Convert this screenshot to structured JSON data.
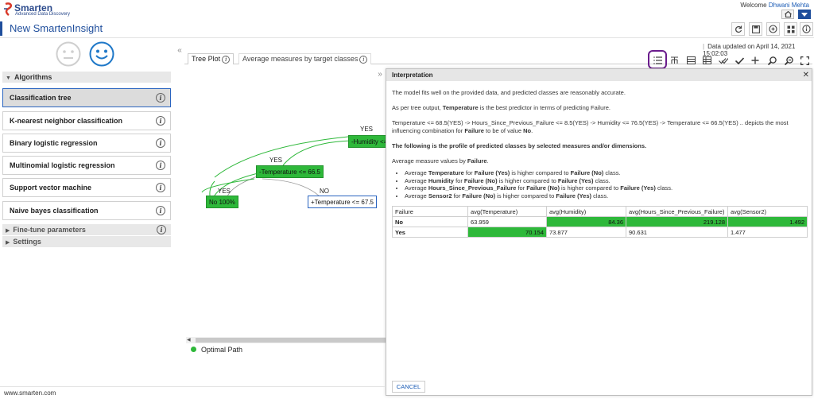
{
  "brand": {
    "name": "Smarten",
    "tagline": "Advanced Data Discovery"
  },
  "user": {
    "welcome": "Welcome",
    "name": "Dhwani Mehta"
  },
  "app": {
    "title": "New SmartenInsight"
  },
  "status": {
    "data_updated": "Data updated on April 14, 2021 15:02:03"
  },
  "sidebar": {
    "algorithms_label": "Algorithms",
    "items": [
      {
        "label": "Classification tree",
        "active": true
      },
      {
        "label": "K-nearest neighbor classification"
      },
      {
        "label": "Binary logistic regression"
      },
      {
        "label": "Multinomial logistic regression"
      },
      {
        "label": "Support vector machine"
      },
      {
        "label": "Naive bayes classification"
      }
    ],
    "fine_tune_label": "Fine-tune parameters",
    "settings_label": "Settings"
  },
  "tabs": [
    {
      "label": "Tree Plot"
    },
    {
      "label": "Average measures by target classes"
    }
  ],
  "tree": {
    "nodes": {
      "humidity": "Humidity <=",
      "temperature1": "Temperature <= 66.5",
      "leaf_no": "No 100%",
      "temperature2": "Temperature <= 67.5"
    },
    "edges": {
      "yes1": "YES",
      "yes2": "YES",
      "yes3": "YES",
      "no1": "NO"
    },
    "legend": "Optimal Path"
  },
  "dialog": {
    "title": "Interpretation",
    "p1": "The model fits well on the provided data, and predicted classes are reasonably accurate.",
    "p2_pre": "As per tree output, ",
    "p2_bold": "Temperature",
    "p2_post": " is the best predictor in terms of predicting Failure.",
    "p3_pre": "Temperature <= 68.5(YES) -> Hours_Since_Previous_Failure <= 8.5(YES) -> Humidity <= 76.5(YES) -> Temperature <= 66.5(YES) .. depicts the most influencing combination for ",
    "p3_bold1": "Failure",
    "p3_mid": " to be of value ",
    "p3_bold2": "No",
    "p3_end": ".",
    "profile_heading": "The following is the profile of predicted classes by selected measures and/or dimensions.",
    "avg_pre": "Average measure values by ",
    "avg_bold": "Failure",
    "avg_end": ".",
    "bullets": [
      {
        "a": "Average ",
        "m": "Temperature",
        "b": " for ",
        "c1": "Failure (Yes)",
        "d": " is higher compared to ",
        "c2": "Failure (No)",
        "e": " class."
      },
      {
        "a": "Average ",
        "m": "Humidity",
        "b": " for ",
        "c1": "Failure (No)",
        "d": " is higher compared to ",
        "c2": "Failure (Yes)",
        "e": " class."
      },
      {
        "a": "Average ",
        "m": "Hours_Since_Previous_Failure",
        "b": " for ",
        "c1": "Failure (No)",
        "d": " is higher compared to ",
        "c2": "Failure (Yes)",
        "e": " class."
      },
      {
        "a": "Average ",
        "m": "Sensor2",
        "b": " for ",
        "c1": "Failure (No)",
        "d": " is higher compared to ",
        "c2": "Failure (Yes)",
        "e": " class."
      }
    ],
    "table": {
      "headers": [
        "Failure",
        "avg(Temperature)",
        "avg(Humidity)",
        "avg(Hours_Since_Previous_Failure)",
        "avg(Sensor2)"
      ],
      "rows": [
        {
          "label": "No",
          "values": [
            "63.959",
            "84.36",
            "219.128",
            "1.492"
          ],
          "highlight": [
            false,
            true,
            true,
            true
          ]
        },
        {
          "label": "Yes",
          "values": [
            "70.154",
            "73.877",
            "90.631",
            "1.477"
          ],
          "highlight": [
            true,
            false,
            false,
            false
          ]
        }
      ]
    },
    "cancel_label": "CANCEL"
  },
  "footer": {
    "url": "www.smarten.com"
  },
  "colors": {
    "accent": "#1f4e9c",
    "highlight_green": "#2eb83a",
    "tool_ring": "#6a1c8c"
  }
}
